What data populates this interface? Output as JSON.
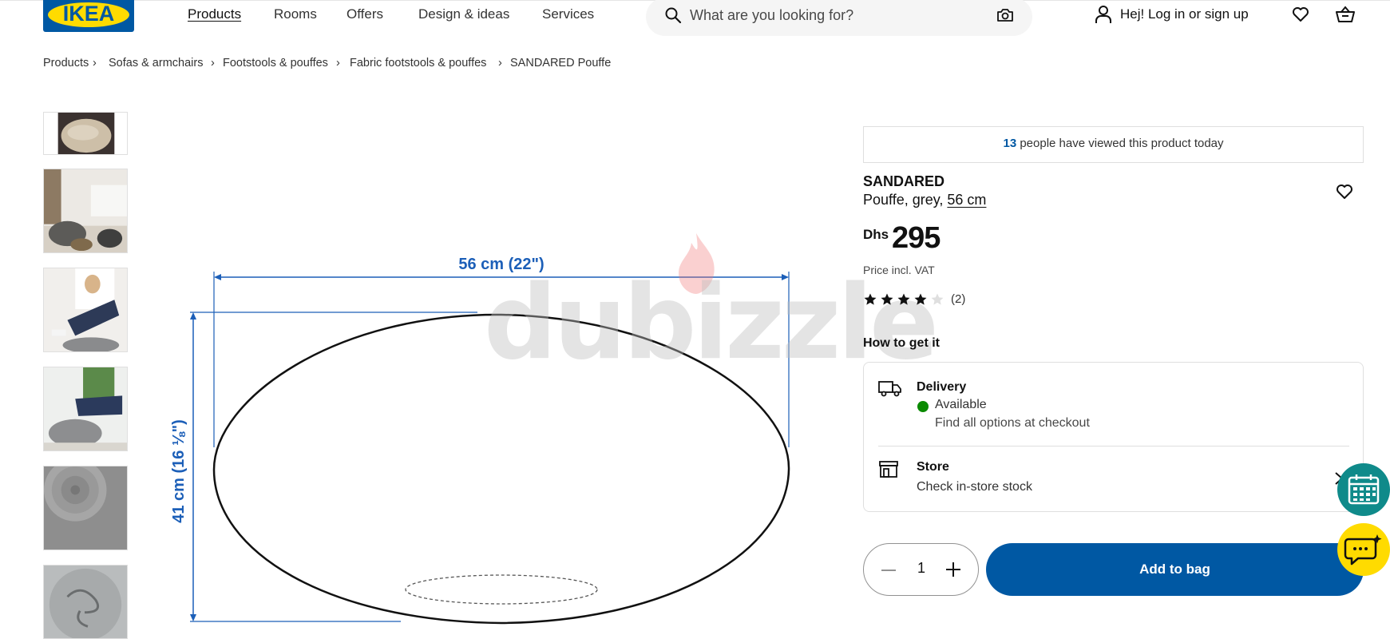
{
  "header": {
    "logo_text": "IKEA",
    "nav": [
      "Products",
      "Rooms",
      "Offers",
      "Design & ideas",
      "Services"
    ],
    "search_placeholder": "What are you looking for?",
    "login_label": "Hej! Log in or sign up"
  },
  "breadcrumb": [
    "Products",
    "Sofas & armchairs",
    "Footstools & pouffes",
    "Fabric footstools & pouffes",
    "SANDARED Pouffe"
  ],
  "diagram": {
    "width_label": "56 cm (22\")",
    "height_label": "41 cm (16 ⅛\")"
  },
  "watermark": "dubizzle",
  "product": {
    "viewed_count": "13",
    "viewed_text": " people have viewed this product today",
    "name": "SANDARED",
    "desc_prefix": "Pouffe, grey, ",
    "desc_size": "56 cm",
    "currency": "Dhs",
    "price": "295",
    "vat_note": "Price incl. VAT",
    "rating": 4,
    "rating_max": 5,
    "review_count": "(2)"
  },
  "availability": {
    "heading": "How to get it",
    "delivery_title": "Delivery",
    "delivery_status": "Available",
    "delivery_note": "Find all options at checkout",
    "store_title": "Store",
    "store_note": "Check in-store stock"
  },
  "purchase": {
    "quantity": "1",
    "add_label": "Add to bag"
  },
  "colors": {
    "brand_blue": "#0058a3",
    "brand_yellow": "#ffdb00",
    "available_green": "#0a8a00",
    "dimension_blue": "#1c5fb8",
    "fab_teal": "#0f8a8a"
  }
}
